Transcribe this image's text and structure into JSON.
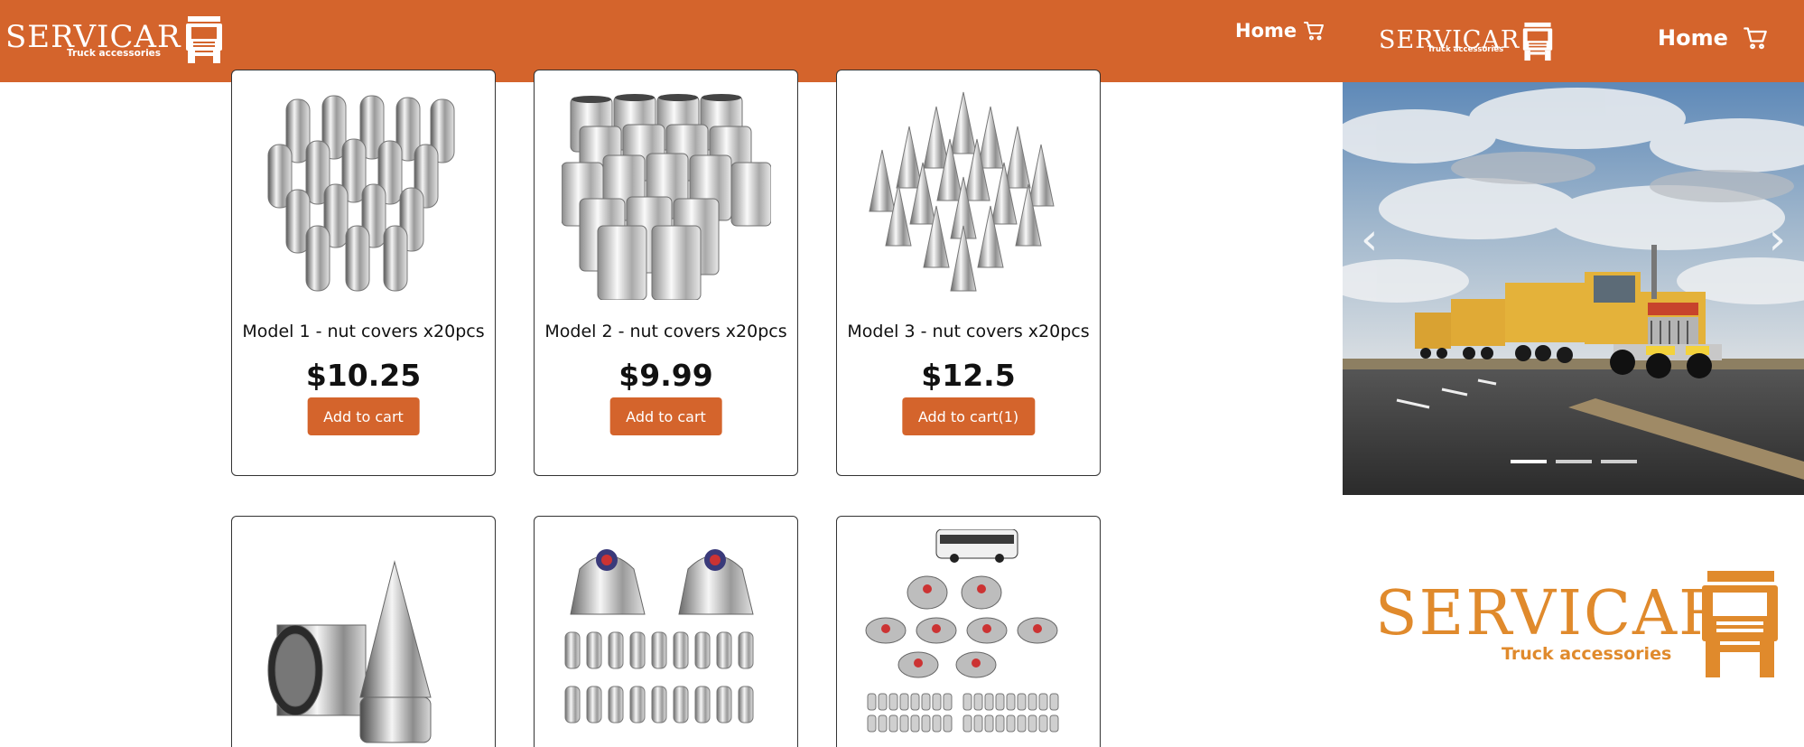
{
  "left_window": {
    "brand": {
      "name": "SERVICAR",
      "tagline": "Truck accessories"
    },
    "nav": {
      "home": "Home"
    },
    "products": [
      {
        "title": "Model 1 - nut covers x20pcs",
        "price": "$10.25",
        "button": "Add to cart"
      },
      {
        "title": "Model 2 - nut covers x20pcs",
        "price": "$9.99",
        "button": "Add to cart"
      },
      {
        "title": "Model 3 - nut covers x20pcs",
        "price": "$12.5",
        "button": "Add to cart(1)"
      },
      {
        "title": "",
        "price": "",
        "button": ""
      },
      {
        "title": "",
        "price": "",
        "button": ""
      },
      {
        "title": "",
        "price": "",
        "button": ""
      }
    ]
  },
  "right_window": {
    "brand": {
      "name": "SERVICAR",
      "tagline": "Truck accessories"
    },
    "nav": {
      "home": "Home"
    },
    "carousel": {
      "slide_count": 3,
      "active_slide": 1
    },
    "footer_logo": {
      "name": "SERVICAR",
      "tagline": "Truck accessories"
    }
  },
  "colors": {
    "brand_orange": "#d4642c",
    "logo_orange": "#e08a2c"
  }
}
